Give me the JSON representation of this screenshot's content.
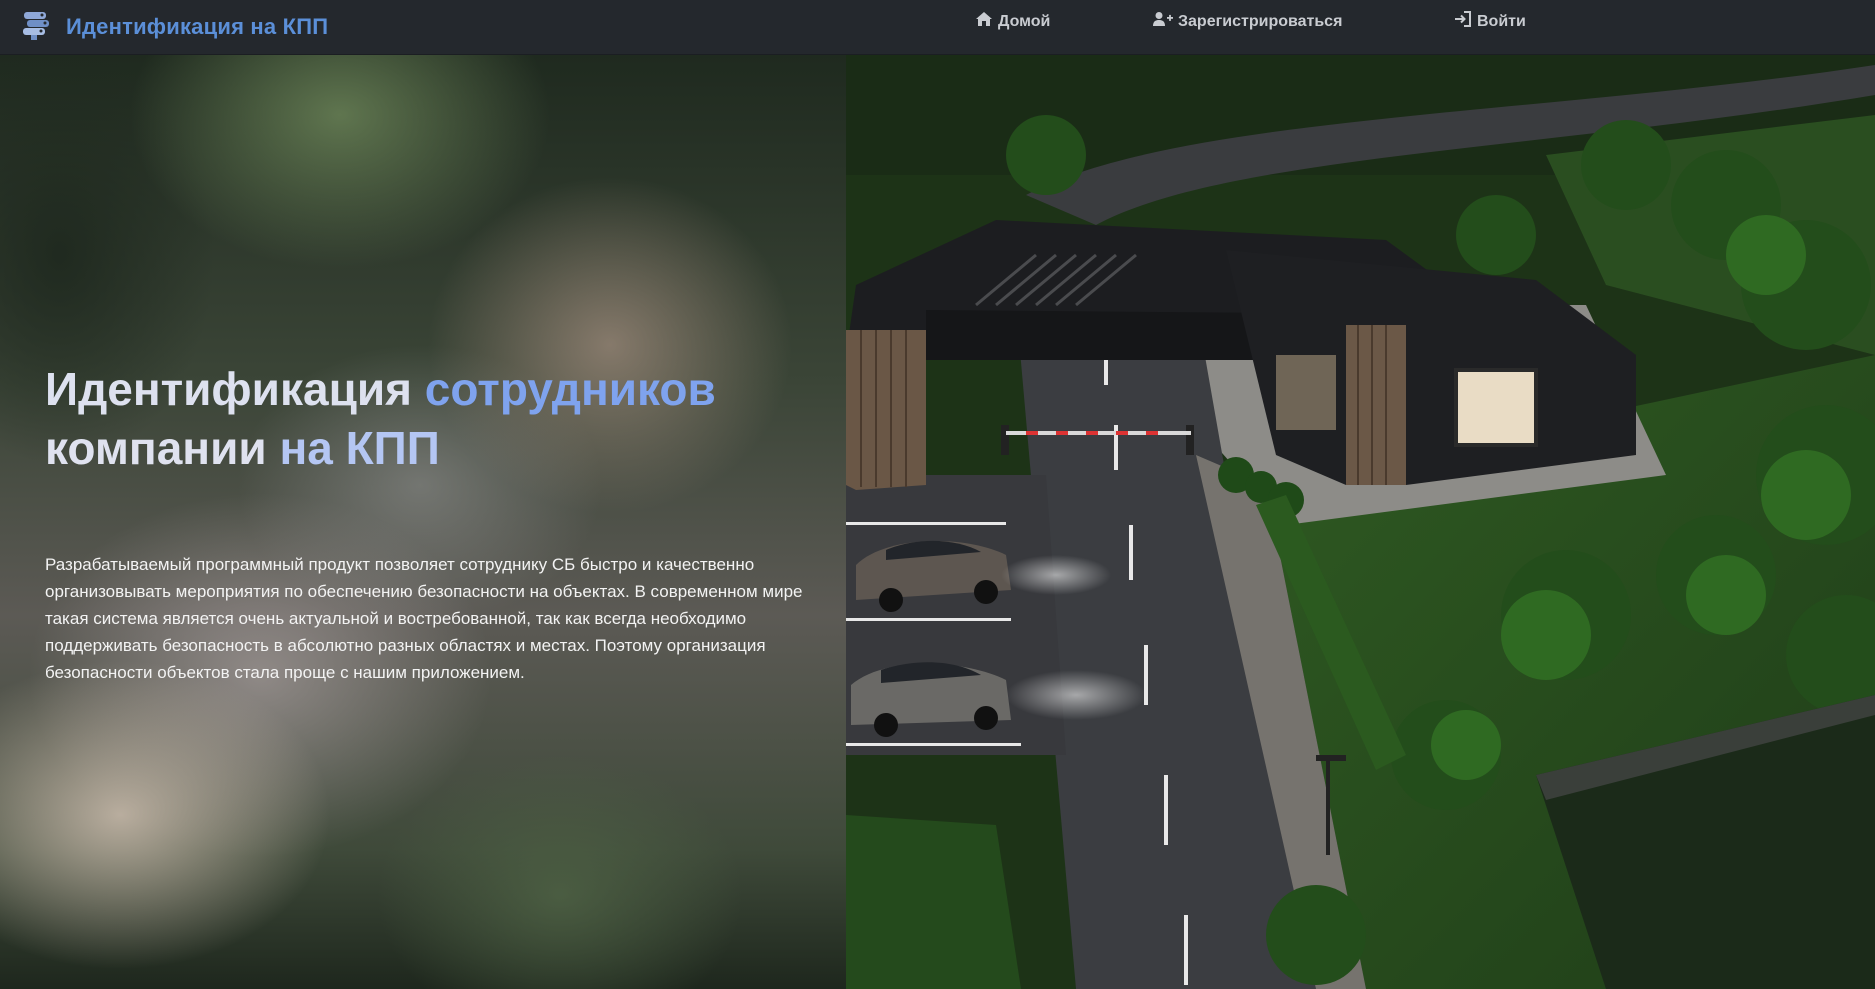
{
  "navbar": {
    "brand": "Идентификация на КПП",
    "links": [
      {
        "label": "Домой",
        "icon": "home-icon"
      },
      {
        "label": "Зарегистрироваться",
        "icon": "user-plus-icon"
      },
      {
        "label": "Войти",
        "icon": "sign-in-icon"
      }
    ]
  },
  "hero": {
    "title_part1": "Идентификация ",
    "title_part2": "сотрудников",
    "title_part3": "компании ",
    "title_part4": "на КПП",
    "description": "Разрабатываемый программный продукт позволяет сотруднику СБ быстро и качественно организовывать мероприятия по обеспечению безопасности на объектах. В современном мире такая система является очень актуальной и востребованной, так как всегда необходимо поддерживать безопасность в абсолютно разных областях и местах. Поэтому организация безопасности объектов стала проще с нашим приложением.",
    "image": "checkpoint-render-image"
  },
  "colors": {
    "navbar_bg": "#24282d",
    "brand_blue": "#5b8fd8",
    "accent_blue": "#7fa3ee"
  }
}
